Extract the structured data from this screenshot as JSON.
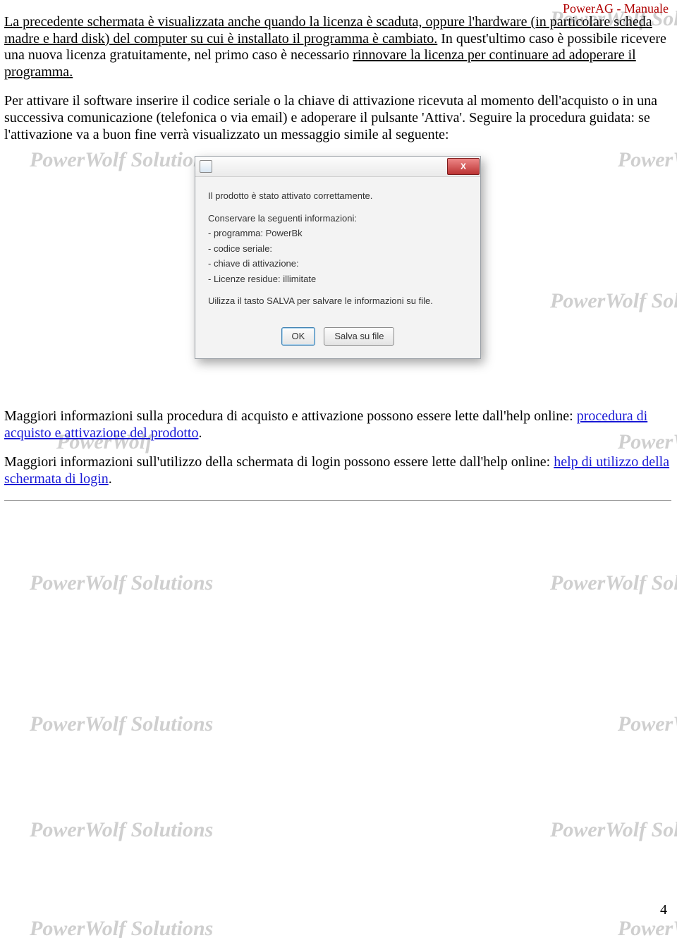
{
  "header": {
    "title": "PowerAG - Manuale"
  },
  "page_number": "4",
  "paragraphs": {
    "p1_u1": "La precedente schermata è visualizzata anche quando la licenza è scaduta, oppure l'hardware (in particolare scheda madre e hard disk) del computer su cui è installato il programma è cambiato.",
    "p1_rest": " In quest'ultimo caso è possibile ricevere una nuova licenza gratuitamente, nel primo caso è necessario ",
    "p1_u2": "rinnovare la licenza per continuare ad adoperare il programma.",
    "p2": "Per attivare il software inserire il codice seriale o la chiave di attivazione ricevuta al momento dell'acquisto o in una successiva comunicazione (telefonica o via email) e adoperare il pulsante 'Attiva'. Seguire la procedura guidata: se l'attivazione va a buon fine verrà visualizzato un messaggio simile al seguente:",
    "p3_pre": "Maggiori informazioni sulla procedura di acquisto e attivazione possono essere lette dall'help online: ",
    "p3_link": "procedura di acquisto e attivazione del prodotto",
    "p3_post": ".",
    "p4_pre": "Maggiori informazioni sull'utilizzo della schermata di login possono essere lette dall'help online: ",
    "p4_link": "help di utilizzo della schermata di login",
    "p4_post": "."
  },
  "dialog": {
    "line_activated": "Il prodotto è stato attivato correttamente.",
    "line_keep": "Conservare la seguenti informazioni:",
    "line_prog": "- programma: PowerBk",
    "line_serial": "- codice seriale:",
    "line_key": "- chiave di attivazione:",
    "line_lic": "- Licenze residue: illimitate",
    "line_save": "Uilizza il tasto SALVA per salvare le informazioni su file.",
    "btn_ok": "OK",
    "btn_save": "Salva su file"
  },
  "watermarks": {
    "left": "PowerWolf Solutions",
    "right_a": "PowerWolf Solutio",
    "right_b": "PowerWolf"
  }
}
